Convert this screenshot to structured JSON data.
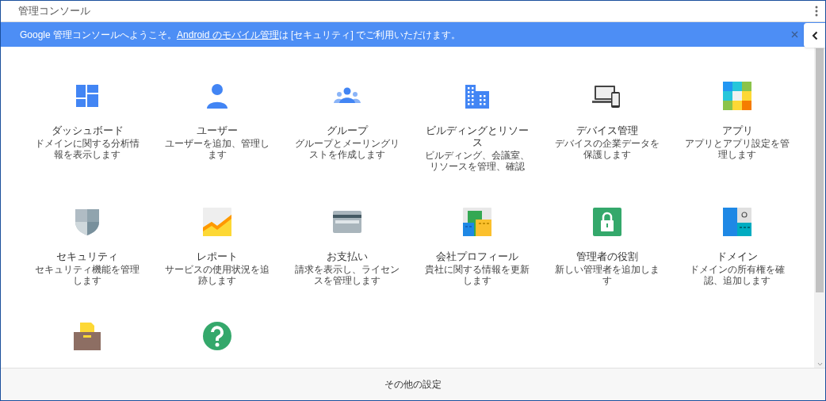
{
  "app_bar": {
    "title": "管理コンソール"
  },
  "banner": {
    "text_before": "Google 管理コンソールへようこそ。",
    "link": "Android のモバイル管理",
    "text_after": "は [セキュリティ] でご利用いただけます。"
  },
  "tiles": [
    {
      "kind": "dashboard",
      "title": "ダッシュボード",
      "description": "ドメインに関する分析情報を表示します"
    },
    {
      "kind": "users",
      "title": "ユーザー",
      "description": "ユーザーを追加、管理します"
    },
    {
      "kind": "groups",
      "title": "グループ",
      "description": "グループとメーリングリストを作成します"
    },
    {
      "kind": "buildings",
      "title": "ビルディングとリソース",
      "description": "ビルディング、会議室、リソースを管理、確認"
    },
    {
      "kind": "devices",
      "title": "デバイス管理",
      "description": "デバイスの企業データを保護します"
    },
    {
      "kind": "apps",
      "title": "アプリ",
      "description": "アプリとアプリ設定を管理します"
    },
    {
      "kind": "security",
      "title": "セキュリティ",
      "description": "セキュリティ機能を管理します"
    },
    {
      "kind": "reports",
      "title": "レポート",
      "description": "サービスの使用状況を追跡します"
    },
    {
      "kind": "billing",
      "title": "お支払い",
      "description": "請求を表示し、ライセンスを管理します"
    },
    {
      "kind": "company",
      "title": "会社プロフィール",
      "description": "貴社に関する情報を更新します"
    },
    {
      "kind": "admin_roles",
      "title": "管理者の役割",
      "description": "新しい管理者を追加します"
    },
    {
      "kind": "domains",
      "title": "ドメイン",
      "description": "ドメインの所有権を確認、追加します"
    },
    {
      "kind": "migration"
    },
    {
      "kind": "support"
    }
  ],
  "footer": {
    "label": "その他の設定"
  }
}
